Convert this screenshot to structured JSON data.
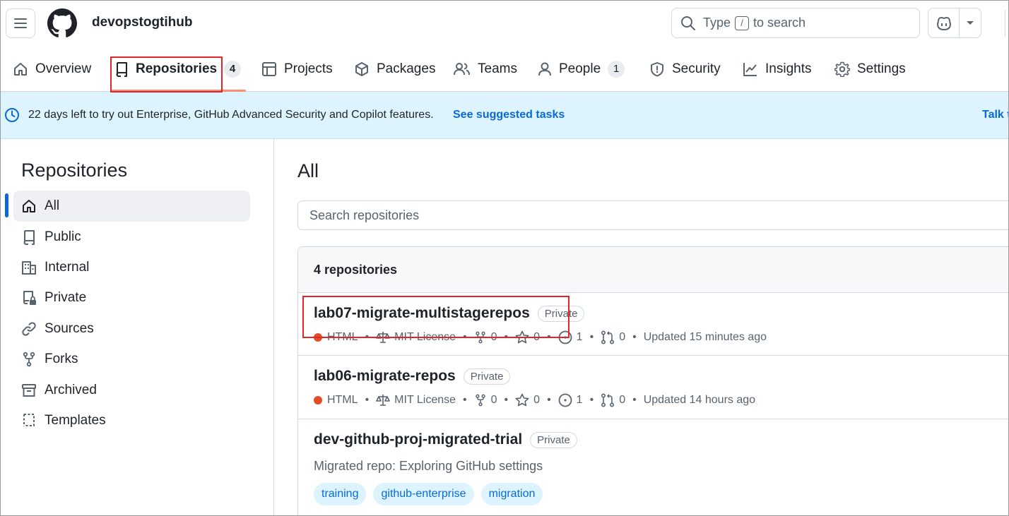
{
  "header": {
    "org_name": "devopstogtihub",
    "search_prefix": "Type",
    "search_key": "/",
    "search_suffix": "to search"
  },
  "nav": {
    "tabs": [
      {
        "label": "Overview",
        "icon": "home-icon"
      },
      {
        "label": "Repositories",
        "icon": "repo-icon",
        "count": "4",
        "active": true
      },
      {
        "label": "Projects",
        "icon": "table-icon"
      },
      {
        "label": "Packages",
        "icon": "package-icon"
      },
      {
        "label": "Teams",
        "icon": "people-icon"
      },
      {
        "label": "People",
        "icon": "person-icon",
        "count": "1"
      },
      {
        "label": "Security",
        "icon": "shield-icon"
      },
      {
        "label": "Insights",
        "icon": "graph-icon"
      },
      {
        "label": "Settings",
        "icon": "gear-icon"
      }
    ]
  },
  "banner": {
    "message": "22 days left to try out Enterprise, GitHub Advanced Security and Copilot features.",
    "link": "See suggested tasks",
    "right_link": "Talk t"
  },
  "sidebar": {
    "title": "Repositories",
    "items": [
      {
        "label": "All",
        "icon": "home-icon",
        "active": true
      },
      {
        "label": "Public",
        "icon": "repo-icon"
      },
      {
        "label": "Internal",
        "icon": "organization-icon"
      },
      {
        "label": "Private",
        "icon": "repo-locked-icon"
      },
      {
        "label": "Sources",
        "icon": "link-icon"
      },
      {
        "label": "Forks",
        "icon": "fork-icon"
      },
      {
        "label": "Archived",
        "icon": "archive-icon"
      },
      {
        "label": "Templates",
        "icon": "template-icon"
      }
    ]
  },
  "main": {
    "title": "All",
    "search_placeholder": "Search repositories",
    "count_label": "4 repositories",
    "repos": [
      {
        "name": "lab07-migrate-multistagerepos",
        "visibility": "Private",
        "language": "HTML",
        "license": "MIT License",
        "forks": "0",
        "stars": "0",
        "issues": "1",
        "pulls": "0",
        "updated": "Updated 15 minutes ago"
      },
      {
        "name": "lab06-migrate-repos",
        "visibility": "Private",
        "language": "HTML",
        "license": "MIT License",
        "forks": "0",
        "stars": "0",
        "issues": "1",
        "pulls": "0",
        "updated": "Updated 14 hours ago"
      },
      {
        "name": "dev-github-proj-migrated-trial",
        "visibility": "Private",
        "description": "Migrated repo: Exploring GitHub settings",
        "topics": [
          "training",
          "github-enterprise",
          "migration"
        ]
      }
    ]
  },
  "colors": {
    "accent": "#0969da",
    "tab_underline": "#fd8c73",
    "html_language": "#e34c26",
    "highlight_box": "#e0252b",
    "banner_bg": "#ddf4ff"
  }
}
